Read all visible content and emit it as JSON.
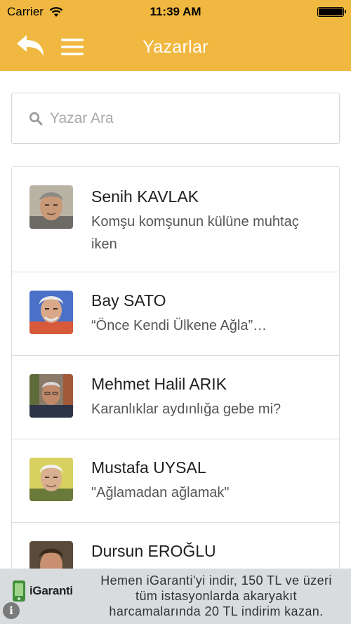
{
  "status_bar": {
    "carrier": "Carrier",
    "time": "11:39 AM",
    "battery_level": 1.0
  },
  "nav": {
    "title": "Yazarlar",
    "back_icon": "back-arrow-icon",
    "menu_icon": "hamburger-menu-icon"
  },
  "search": {
    "placeholder": "Yazar Ara",
    "value": ""
  },
  "authors": [
    {
      "name": "Senih KAVLAK",
      "excerpt": "Komşu komşunun külüne muhtaç iken"
    },
    {
      "name": "Bay SATO",
      "excerpt": "“Önce Kendi Ülkene Ağla”…"
    },
    {
      "name": "Mehmet Halil ARIK",
      "excerpt": "Karanlıklar aydınlığa gebe mi?"
    },
    {
      "name": "Mustafa UYSAL",
      "excerpt": "\"Ağlamadan ağlamak\""
    },
    {
      "name": "Dursun EROĞLU",
      "excerpt": ""
    }
  ],
  "ad": {
    "brand": "iGaranti",
    "lines": [
      "Hemen iGaranti'yi indir, 150 TL ve üzeri",
      "tüm istasyonlarda akaryakıt",
      "harcamalarında 20 TL indirim kazan."
    ],
    "info_label": "i"
  },
  "colors": {
    "header": "#f0b840",
    "ad_background": "#d9dcdf"
  }
}
